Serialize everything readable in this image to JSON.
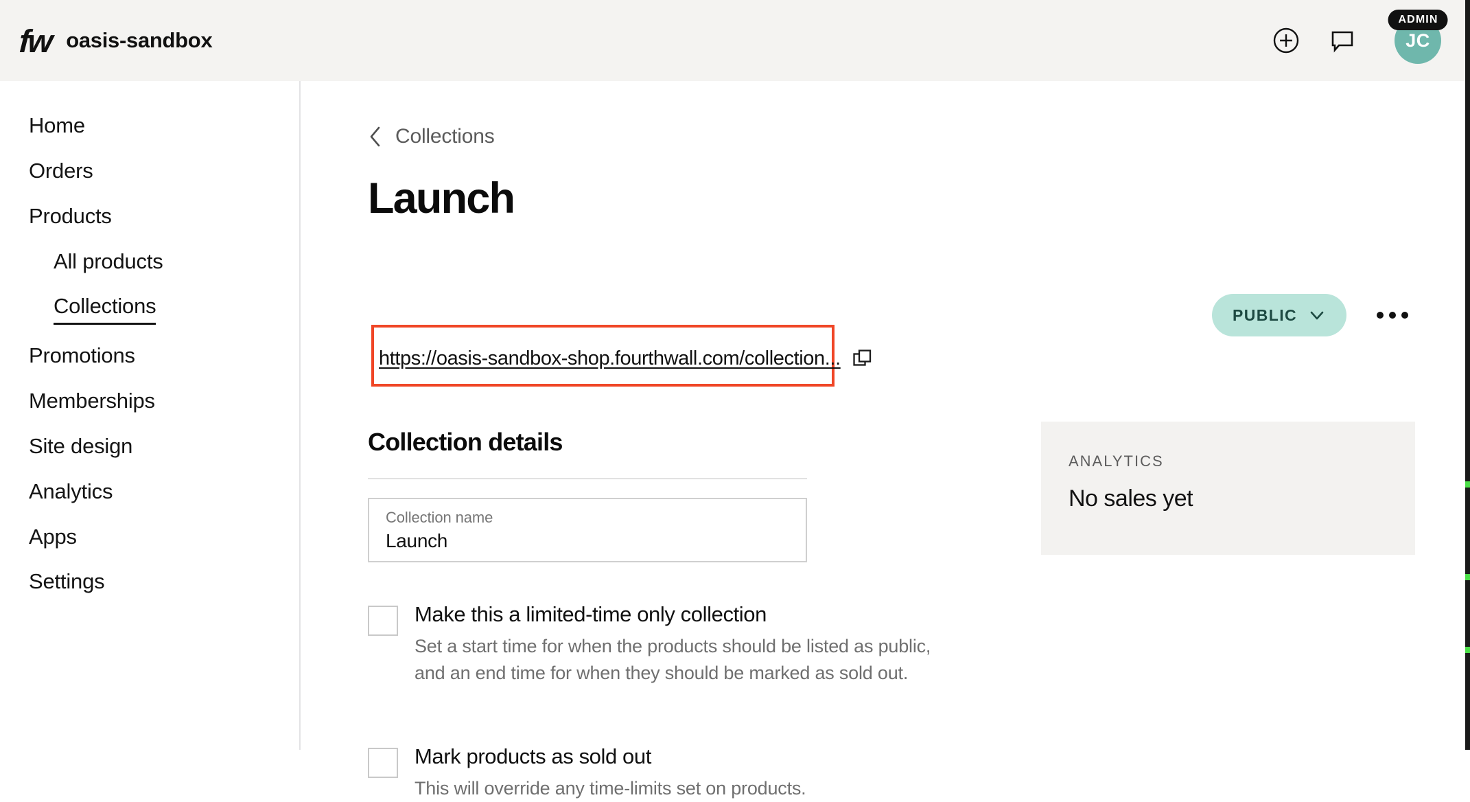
{
  "topbar": {
    "logo_text": "fw",
    "logo_icon": "fourthwall-logo",
    "brand_name": "oasis-sandbox",
    "add_icon": "plus-circle-icon",
    "feedback_icon": "chat-bubble-icon",
    "avatar_initials": "JC",
    "admin_badge": "ADMIN",
    "avatar_color": "#6fb7ac",
    "badge_color": "#111111",
    "background": "#f4f3f1"
  },
  "sidebar": {
    "items": [
      {
        "label": "Home",
        "sub": false,
        "active": false
      },
      {
        "label": "Orders",
        "sub": false,
        "active": false
      },
      {
        "label": "Products",
        "sub": false,
        "active": false
      },
      {
        "label": "All products",
        "sub": true,
        "active": false
      },
      {
        "label": "Collections",
        "sub": true,
        "active": true
      },
      {
        "label": "Promotions",
        "sub": false,
        "active": false
      },
      {
        "label": "Memberships",
        "sub": false,
        "active": false
      },
      {
        "label": "Site design",
        "sub": false,
        "active": false
      },
      {
        "label": "Analytics",
        "sub": false,
        "active": false
      },
      {
        "label": "Apps",
        "sub": false,
        "active": false
      },
      {
        "label": "Settings",
        "sub": false,
        "active": false
      }
    ]
  },
  "main": {
    "breadcrumb": {
      "back_icon": "chevron-left-icon",
      "label": "Collections"
    },
    "page_title": "Launch",
    "url": {
      "text": "https://oasis-sandbox-shop.fourthwall.com/collection...",
      "copy_icon": "copy-icon",
      "highlight_color": "#f04626"
    },
    "status": {
      "label": "PUBLIC",
      "chevron_icon": "chevron-down-icon",
      "pill_color": "#b9e4da",
      "more_icon": "ellipsis-horizontal-icon"
    },
    "section": {
      "title": "Collection details",
      "name_field": {
        "label": "Collection name",
        "value": "Launch"
      },
      "options": [
        {
          "title": "Make this a limited-time only collection",
          "description": "Set a start time for when the products should be listed as public, and an end time for when they should be marked as sold out.",
          "checked": false
        },
        {
          "title": "Mark products as sold out",
          "description": "This will override any time-limits set on products.",
          "checked": false
        }
      ]
    },
    "analytics": {
      "kicker": "ANALYTICS",
      "value": "No sales yet",
      "background": "#f3f2f0"
    }
  },
  "edge_strip": {
    "color": "#1a1a1a",
    "mark_color": "#4ce049",
    "marks": [
      701,
      836,
      942
    ]
  }
}
